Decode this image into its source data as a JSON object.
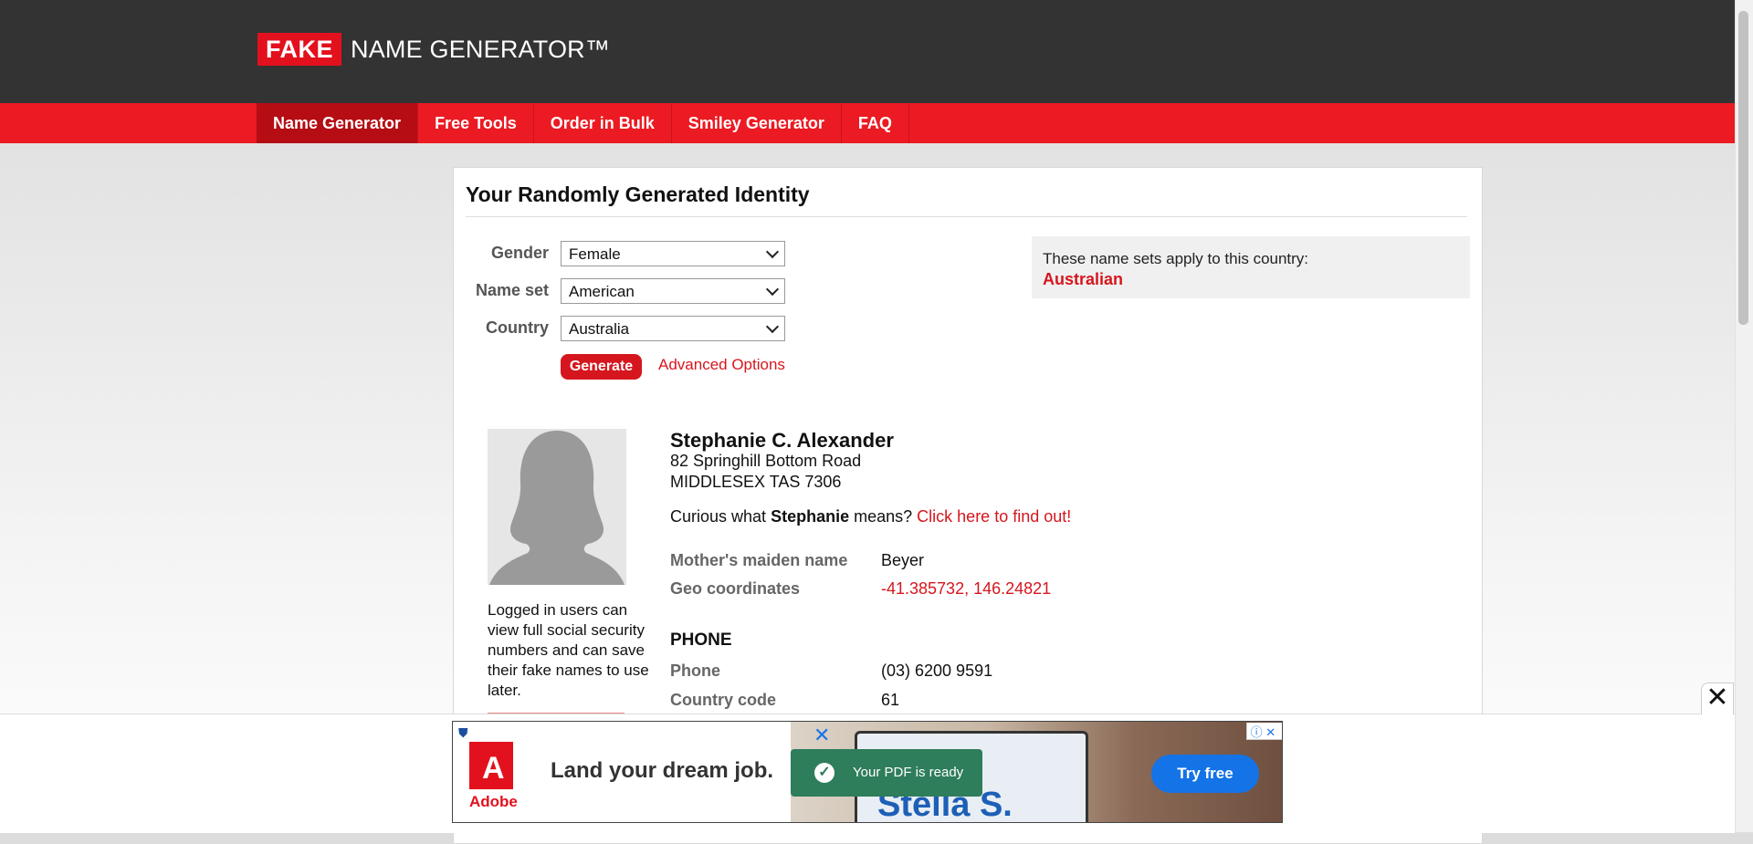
{
  "brand": {
    "logo_box": "FAKE",
    "logo_text": "NAME GENERATOR™"
  },
  "nav": {
    "items": [
      "Name Generator",
      "Free Tools",
      "Order in Bulk",
      "Smiley Generator",
      "FAQ"
    ],
    "active": "Name Generator"
  },
  "panel": {
    "title": "Your Randomly Generated Identity"
  },
  "form": {
    "gender_label": "Gender",
    "gender_value": "Female",
    "nameset_label": "Name set",
    "nameset_value": "American",
    "country_label": "Country",
    "country_value": "Australia",
    "generate_label": "Generate",
    "advanced_label": "Advanced Options"
  },
  "country_info": {
    "text": "These name sets apply to this country:",
    "name": "Australian"
  },
  "identity": {
    "name": "Stephanie C. Alexander",
    "address_line1": "82 Springhill Bottom Road",
    "address_line2": "MIDDLESEX TAS 7306",
    "curious_prefix": "Curious what",
    "curious_name": "Stephanie",
    "curious_suffix": "means?",
    "curious_link": "Click here to find out!",
    "maiden_label": "Mother's maiden name",
    "maiden_value": "Beyer",
    "geo_label": "Geo coordinates",
    "geo_value": "-41.385732, 146.24821"
  },
  "phone": {
    "heading": "PHONE",
    "phone_label": "Phone",
    "phone_value": "(03) 6200 9591",
    "code_label": "Country code",
    "code_value": "61"
  },
  "login_note": "Logged in users can view full social security numbers and can save their fake names to use later.",
  "ad": {
    "brand": "Adobe",
    "headline": "Land your dream job.",
    "toast": "Your PDF is ready",
    "cta": "Try free",
    "image_text": "Stella S."
  },
  "colors": {
    "brand_red": "#ec1a22",
    "dark_header": "#333333",
    "link_red": "#d6161e"
  }
}
